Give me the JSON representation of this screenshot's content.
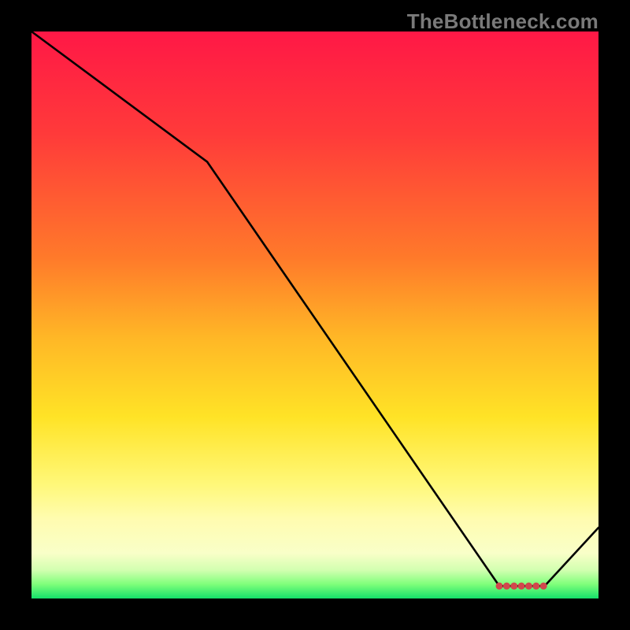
{
  "watermark": "TheBottleneck.com",
  "chart_data": {
    "type": "line",
    "title": "",
    "xlabel": "",
    "ylabel": "",
    "xlim": [
      0,
      100
    ],
    "ylim": [
      0,
      100
    ],
    "series": [
      {
        "name": "curve",
        "x": [
          0,
          31,
          82.5,
          87,
          90.5,
          100
        ],
        "y": [
          100,
          77,
          2.2,
          2.2,
          2.2,
          12.5
        ]
      }
    ],
    "markers": {
      "name": "cluster",
      "color": "#d2474c",
      "radius": 4.5,
      "points": [
        {
          "x": 82.5,
          "y": 2.2
        },
        {
          "x": 83.8,
          "y": 2.2
        },
        {
          "x": 85.1,
          "y": 2.2
        },
        {
          "x": 86.4,
          "y": 2.2
        },
        {
          "x": 87.7,
          "y": 2.2
        },
        {
          "x": 89.0,
          "y": 2.2
        },
        {
          "x": 90.3,
          "y": 2.2
        }
      ]
    }
  }
}
